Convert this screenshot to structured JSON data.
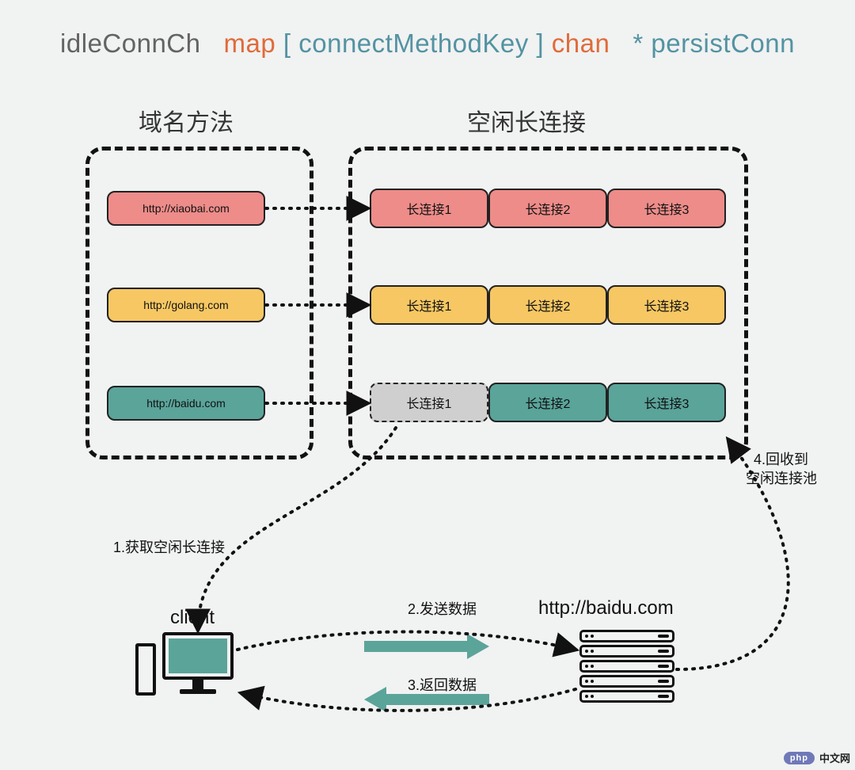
{
  "title": {
    "ident": "idleConnCh",
    "map": "map",
    "lbr": "[",
    "keytype": "connectMethodKey",
    "rbr": "]",
    "chan": "chan",
    "star": "*",
    "valtype": "persistConn"
  },
  "section_labels": {
    "keys": "域名方法",
    "pool": "空闲长连接"
  },
  "keys": [
    {
      "id": "xiaobai",
      "label": "http://xiaobai.com",
      "color": "c-red"
    },
    {
      "id": "golang",
      "label": "http://golang.com",
      "color": "c-amber"
    },
    {
      "id": "baidu",
      "label": "http://baidu.com",
      "color": "c-teal"
    }
  ],
  "pool_rows": [
    {
      "color": "c-red",
      "cells": [
        {
          "label": "长连接1"
        },
        {
          "label": "长连接2"
        },
        {
          "label": "长连接3"
        }
      ]
    },
    {
      "color": "c-amber",
      "cells": [
        {
          "label": "长连接1"
        },
        {
          "label": "长连接2"
        },
        {
          "label": "长连接3"
        }
      ]
    },
    {
      "color": "c-teal",
      "cells": [
        {
          "label": "长连接1",
          "class": "c-gray"
        },
        {
          "label": "长连接2"
        },
        {
          "label": "长连接3"
        }
      ]
    }
  ],
  "steps": {
    "s1": "1.获取空闲长连接",
    "s2": "2.发送数据",
    "s3": "3.返回数据",
    "s4a": "4.回收到",
    "s4b": "空闲连接池"
  },
  "labels": {
    "client": "client",
    "server": "http://baidu.com"
  },
  "watermark": {
    "badge": "php",
    "text": "中文网"
  }
}
